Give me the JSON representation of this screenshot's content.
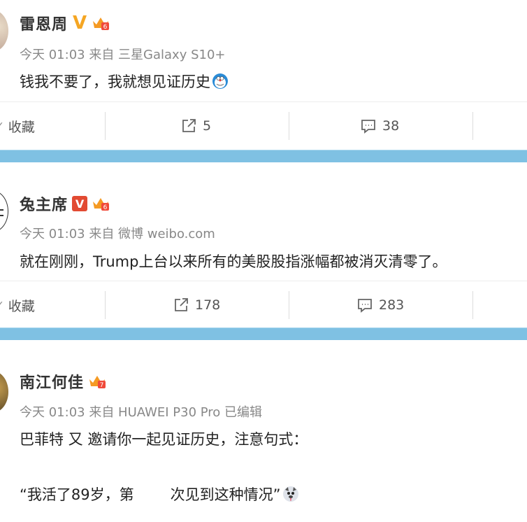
{
  "posts": [
    {
      "name": "雷恩周",
      "meta": "今天 01:03 来自 三星Galaxy S10+",
      "text": "钱我不要了，我就想见证历史",
      "actions": {
        "favorite": "收藏",
        "repost": "5",
        "comment": "38"
      }
    },
    {
      "name": "兔主席",
      "meta": "今天 01:03 来自 微博 weibo.com",
      "text": "就在刚刚，Trump上台以来所有的美股股指涨幅都被消灭清零了。",
      "actions": {
        "favorite": "收藏",
        "repost": "178",
        "comment": "283"
      }
    },
    {
      "name": "南江何佳",
      "meta": "今天 01:03 来自 HUAWEI P30 Pro  已编辑",
      "text_line1": "巴菲特 又  邀请你一起见证历史，注意句式：",
      "text_line2a": "“我活了89岁，第",
      "text_line2b": "次见到这种情况”"
    }
  ],
  "colors": {
    "divider": "#7fc1e3",
    "verified_gold": "#f5a623",
    "verified_red": "#e24a32"
  }
}
